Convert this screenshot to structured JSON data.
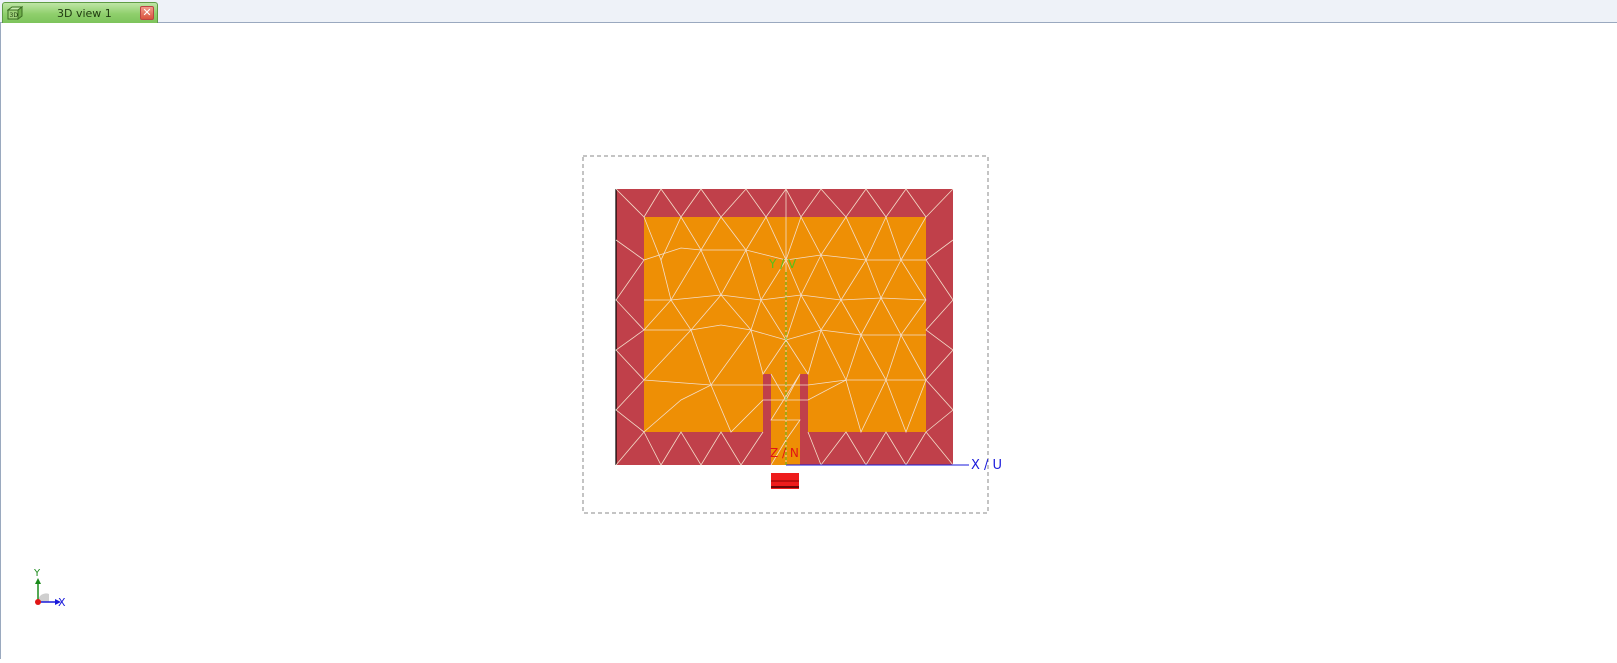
{
  "tab": {
    "icon": "3d-box-icon",
    "icon_text": "3D",
    "label": "3D view 1",
    "close_icon": "close-icon"
  },
  "scene": {
    "axis_x_label": "X / U",
    "axis_y_label": "Y / V",
    "axis_z_label": "Z / N",
    "colors": {
      "substrate": "#c0404a",
      "patch": "#ee8f05",
      "mesh": "#f3ddc9",
      "feed": "#ee1c1c",
      "x_axis": "#1a1adb",
      "y_axis": "#56c01c",
      "z_axis": "#e01515",
      "bounding_box": "#888888"
    }
  },
  "triad": {
    "x_label": "X",
    "y_label": "Y"
  }
}
